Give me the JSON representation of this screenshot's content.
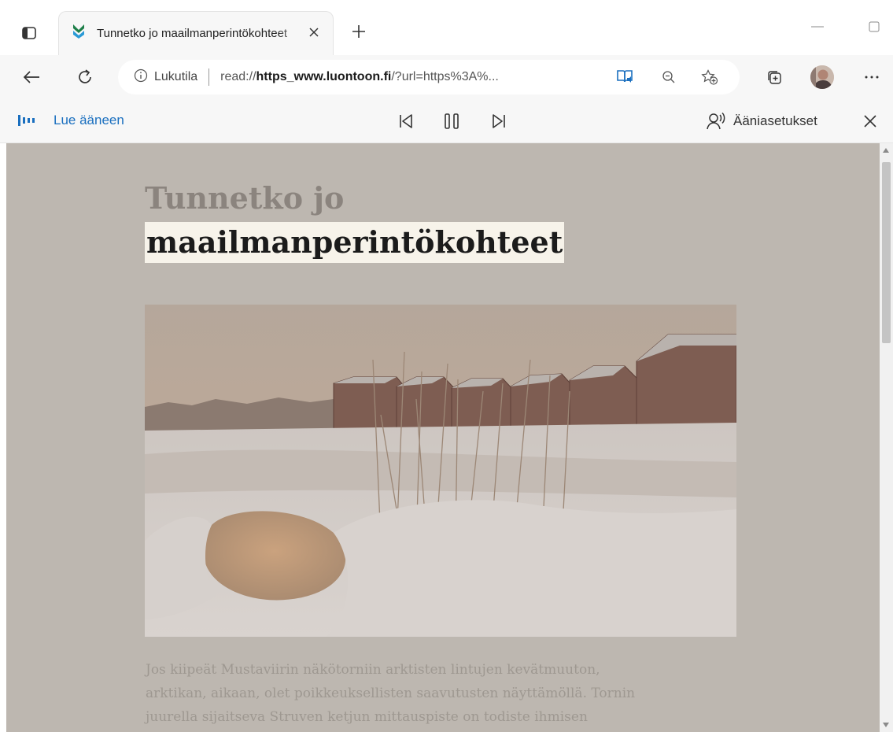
{
  "tab": {
    "title": "Tunnetko jo maailmanperintökohteet",
    "favicon": "luontoon-favicon"
  },
  "address": {
    "mode_label": "Lukutila",
    "url_prefix": "read://",
    "url_domain": "https_www.luontoon.fi",
    "url_rest": "/?url=https%3A%..."
  },
  "read_aloud": {
    "label": "Lue ääneen",
    "voice_settings_label": "Ääniasetukset"
  },
  "article": {
    "title_line1": "Tunnetko jo",
    "title_line2": "maailmanperintökohteet",
    "body_lines": [
      "Jos kiipeät Mustaviirin näkötorniin arktisten lintujen kevätmuuton,",
      "arktikan, aikaan, olet poikkeuksellisten saavutusten näyttämöllä. Tornin",
      "juurella sijaitseva Struven ketjun mittauspiste on todiste ihmisen"
    ]
  },
  "icons": {
    "tab_actions": "tab-actions-icon",
    "close_tab": "close-icon",
    "new_tab": "plus-icon",
    "minimize": "minimize-icon",
    "maximize": "maximize-icon",
    "back": "back-arrow-icon",
    "refresh": "refresh-icon",
    "info": "info-icon",
    "immersive_reader": "immersive-reader-icon",
    "zoom": "zoom-out-icon",
    "favorites": "add-favorite-icon",
    "collections": "collections-icon",
    "profile": "avatar",
    "more": "more-icon",
    "read_aloud": "read-aloud-icon",
    "previous": "previous-icon",
    "pause": "pause-icon",
    "next": "next-icon",
    "voice": "voice-icon"
  },
  "colors": {
    "accent": "#1a6fbf",
    "reader_background": "#bdb7b0",
    "highlight": "#f7f3ea"
  }
}
